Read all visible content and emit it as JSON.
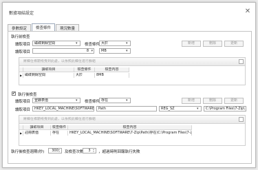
{
  "window": {
    "title": "數據項結設定",
    "close": "✕"
  },
  "tabs": [
    "參數設定",
    "檢查條件",
    "現況數量"
  ],
  "section1": {
    "header": "執行前檢查",
    "row1": {
      "label": "讀取項目",
      "value": "磁碟剩餘空間",
      "cond_label": "檢查條件",
      "cond_value": "大於"
    },
    "row2": {
      "label": "讀取項目",
      "num": "8",
      "unit": "MB"
    },
    "buttons": [
      "新增",
      "刪除",
      "更新"
    ],
    "hint": "將欄位標題拖曳到此處，以依照此欄位進行群組",
    "table": {
      "headers": [
        "讀取項目",
        "檢查條件",
        "檢查內容"
      ],
      "rows": [
        {
          "marker": "▶",
          "item": "磁碟剩餘空間",
          "cond": "大於",
          "content": "8MB"
        }
      ]
    }
  },
  "section2": {
    "header": "執行後檢查",
    "checked": "✔",
    "row1": {
      "label": "讀取項目",
      "value": "登錄表值",
      "cond_label": "檢查條件",
      "cond_value": "存在"
    },
    "row2": {
      "label": "讀取項目",
      "reg_path": "HKEY_LOCAL_MACHINE\\SOFTWARE\\7",
      "reg_name": "Path",
      "reg_type": "REG_SZ",
      "reg_value": "C:\\Program Files\\7-Zip\\"
    },
    "buttons": [
      "新增",
      "刪除",
      "更新"
    ],
    "hint": "將欄位標題拖曳到此處，以依照此欄位進行群組",
    "table": {
      "headers": [
        "讀取項目",
        "檢查條件",
        "檢查內容"
      ],
      "rows": [
        {
          "marker": "▶",
          "item": "註冊表值",
          "cond": "存在",
          "content": "HKEY_LOCAL_MACHINE\\SOFTWARE\\7-Zip\\Path(存在)C:\\Program Files\\7-Zip\\"
        }
      ]
    }
  },
  "footer": {
    "label1": "執行後檢查週期(秒)",
    "interval": "300",
    "label2": "及檢查次數",
    "count": "3",
    "label3": "，超過時則回報執行失敗"
  }
}
